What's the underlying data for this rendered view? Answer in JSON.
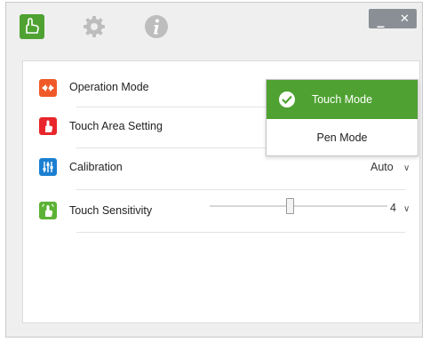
{
  "toolbar": {
    "icons": [
      "touch-icon",
      "gear-icon",
      "info-icon"
    ],
    "minimize_label": "_",
    "close_label": "✕"
  },
  "settings": {
    "operation_mode": {
      "label": "Operation Mode"
    },
    "touch_area": {
      "label": "Touch Area Setting"
    },
    "calibration": {
      "label": "Calibration",
      "value": "Auto",
      "chevron": "∨"
    },
    "touch_sensitivity": {
      "label": "Touch Sensitivity",
      "value": "4",
      "chevron": "∨",
      "slider_level": 0.45
    }
  },
  "mode_dropdown": {
    "options": [
      {
        "label": "Touch Mode",
        "selected": true
      },
      {
        "label": "Pen Mode",
        "selected": false
      }
    ]
  },
  "colors": {
    "accent_green": "#4fa232",
    "operation_orange": "#f05a28",
    "touch_area_red": "#e8262c",
    "calibration_blue": "#1a7fd1",
    "sensitivity_green": "#5cb234",
    "toolbar_gray": "#bdbdbd"
  }
}
